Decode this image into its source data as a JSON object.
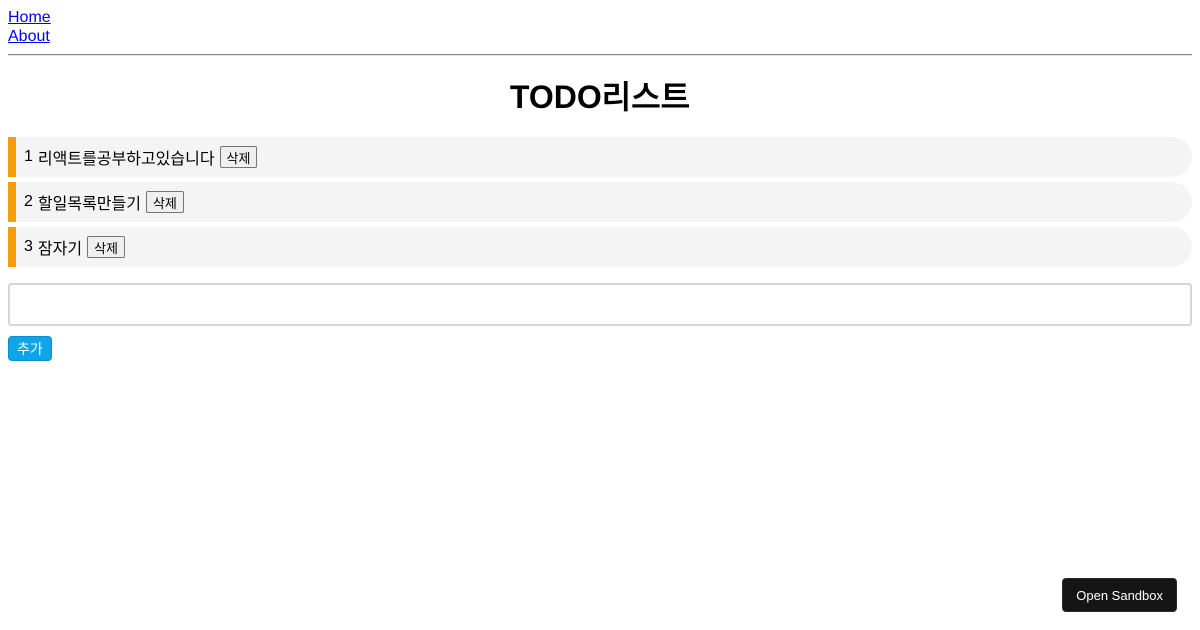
{
  "nav": {
    "home_label": "Home",
    "about_label": "About"
  },
  "header": {
    "title": "TODO리스트"
  },
  "todos": [
    {
      "id": "1",
      "text": "리액트를공부하고있습니다",
      "button_label": "삭제"
    },
    {
      "id": "2",
      "text": "할일목록만들기",
      "button_label": "삭제"
    },
    {
      "id": "3",
      "text": "잠자기",
      "button_label": "삭제"
    }
  ],
  "form": {
    "input_value": "",
    "input_placeholder": "",
    "add_label": "추가"
  },
  "sandbox": {
    "label": "Open Sandbox"
  },
  "colors": {
    "item_accent": "#f59e0b",
    "item_background": "#f4f4f4",
    "add_button": "#0ea5e9",
    "sandbox_button": "#151515",
    "link": "#0000ee"
  }
}
